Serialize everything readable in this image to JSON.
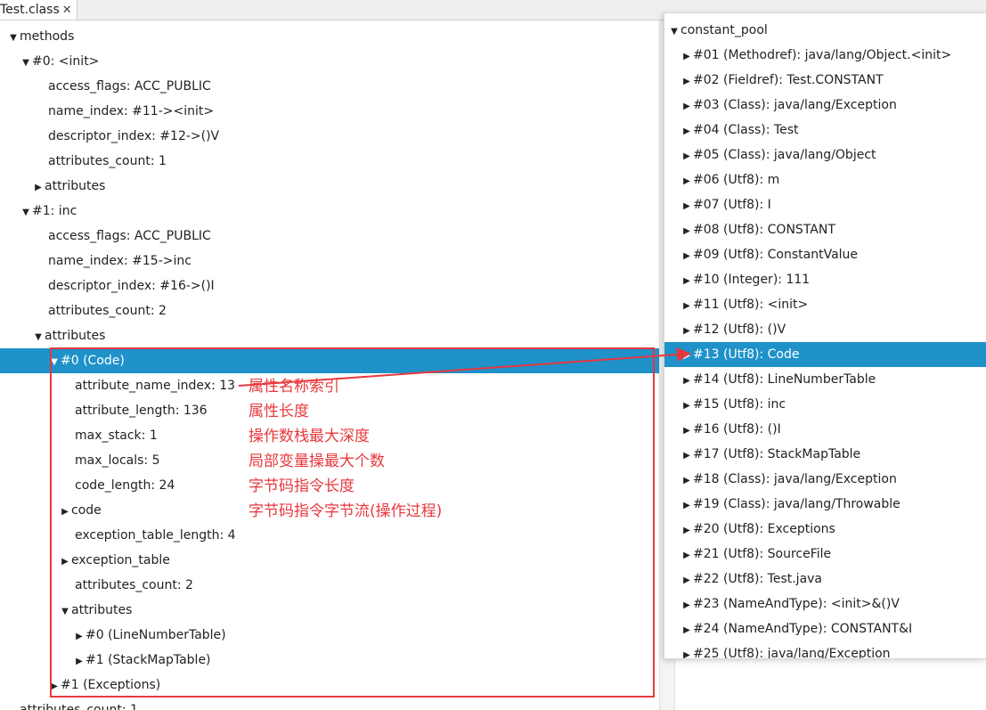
{
  "tab": {
    "label": "Test.class",
    "close": "✕"
  },
  "left_tree": [
    {
      "label": "methods",
      "toggle": "down"
    },
    {
      "label": "#0: <init>",
      "toggle": "down"
    },
    {
      "label": "access_flags: ACC_PUBLIC",
      "toggle": "none"
    },
    {
      "label": "name_index: #11-><init>",
      "toggle": "none"
    },
    {
      "label": "descriptor_index: #12->()V",
      "toggle": "none"
    },
    {
      "label": "attributes_count: 1",
      "toggle": "none"
    },
    {
      "label": "attributes",
      "toggle": "right"
    },
    {
      "label": "#1: inc",
      "toggle": "down"
    },
    {
      "label": "access_flags: ACC_PUBLIC",
      "toggle": "none"
    },
    {
      "label": "name_index: #15->inc",
      "toggle": "none"
    },
    {
      "label": "descriptor_index: #16->()I",
      "toggle": "none"
    },
    {
      "label": "attributes_count: 2",
      "toggle": "none"
    },
    {
      "label": "attributes",
      "toggle": "down"
    },
    {
      "label": "#0 (Code)",
      "toggle": "down",
      "selected": true
    },
    {
      "label": "attribute_name_index: 13",
      "toggle": "none"
    },
    {
      "label": "attribute_length: 136",
      "toggle": "none"
    },
    {
      "label": "max_stack: 1",
      "toggle": "none"
    },
    {
      "label": "max_locals: 5",
      "toggle": "none"
    },
    {
      "label": "code_length: 24",
      "toggle": "none"
    },
    {
      "label": "code",
      "toggle": "right"
    },
    {
      "label": "exception_table_length: 4",
      "toggle": "none"
    },
    {
      "label": "exception_table",
      "toggle": "right"
    },
    {
      "label": "attributes_count: 2",
      "toggle": "none"
    },
    {
      "label": "attributes",
      "toggle": "down"
    },
    {
      "label": "#0 (LineNumberTable)",
      "toggle": "right"
    },
    {
      "label": "#1 (StackMapTable)",
      "toggle": "right"
    },
    {
      "label": "#1 (Exceptions)",
      "toggle": "right"
    },
    {
      "label": "attributes_count: 1",
      "toggle": "none"
    }
  ],
  "annotations": [
    "属性名称索引",
    "属性长度",
    "操作数栈最大深度",
    "局部变量操最大个数",
    "字节码指令长度",
    "字节码指令字节流(操作过程)"
  ],
  "constant_pool": {
    "title": "constant_pool",
    "items": [
      {
        "label": "#01 (Methodref): java/lang/Object.<init>"
      },
      {
        "label": "#02 (Fieldref): Test.CONSTANT"
      },
      {
        "label": "#03 (Class): java/lang/Exception"
      },
      {
        "label": "#04 (Class): Test"
      },
      {
        "label": "#05 (Class): java/lang/Object"
      },
      {
        "label": "#06 (Utf8): m"
      },
      {
        "label": "#07 (Utf8): I"
      },
      {
        "label": "#08 (Utf8): CONSTANT"
      },
      {
        "label": "#09 (Utf8): ConstantValue"
      },
      {
        "label": "#10 (Integer): 111"
      },
      {
        "label": "#11 (Utf8): <init>"
      },
      {
        "label": "#12 (Utf8): ()V"
      },
      {
        "label": "#13 (Utf8): Code",
        "selected": true
      },
      {
        "label": "#14 (Utf8): LineNumberTable"
      },
      {
        "label": "#15 (Utf8): inc"
      },
      {
        "label": "#16 (Utf8): ()I"
      },
      {
        "label": "#17 (Utf8): StackMapTable"
      },
      {
        "label": "#18 (Class): java/lang/Exception"
      },
      {
        "label": "#19 (Class): java/lang/Throwable"
      },
      {
        "label": "#20 (Utf8): Exceptions"
      },
      {
        "label": "#21 (Utf8): SourceFile"
      },
      {
        "label": "#22 (Utf8): Test.java"
      },
      {
        "label": "#23 (NameAndType): <init>&()V"
      },
      {
        "label": "#24 (NameAndType): CONSTANT&I"
      },
      {
        "label": "#25 (Utf8): java/lang/Exception"
      }
    ]
  },
  "colors": {
    "selection": "#1f92c9",
    "annotation": "#e8383d"
  }
}
